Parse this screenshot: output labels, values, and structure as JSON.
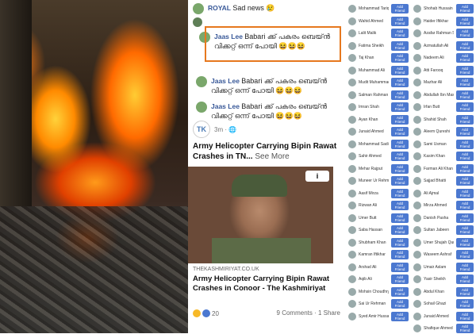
{
  "comments": [
    {
      "name": "ROYAL",
      "text": "Sad news 😢"
    },
    {
      "name": "Jaas Lee",
      "text": "Babari ക്ക് പകരം ബെയ്ൻ വിക്കറ്റ് ഒന്ന് പോയി 😆😆😆"
    },
    {
      "name": "Jaas Lee",
      "text": "Babari ക്ക് പകരം ബെയ്ൻ വിക്കറ്റ് ഒന്ന് പോയി 😆😆😆"
    },
    {
      "name": "Jaas Lee",
      "text": "Babari ക്ക് പകരം ബെയ്ൻ വിക്കറ്റ് ഒന്ന് പോയി 😆😆😆"
    }
  ],
  "post": {
    "logo": "TK",
    "time": "3m · 🌐",
    "title": "Army Helicopter Carrying Bipin Rawat Crashes in TN...",
    "see_more": "See More",
    "badge": "i",
    "source": "THEKASHMIRIYAT.CO.UK",
    "link_title": "Army Helicopter Carrying Bipin Rawat Crashes in Conoor - The Kashmiriyat",
    "reaction_count": "20",
    "stats": "9 Comments · 1 Share"
  },
  "people_col1": [
    "Mohammad Tariq",
    "Wahid Ahmed",
    "Lalit Malik",
    "Fatima Sheikh",
    "Taj Khan",
    "Muhammad Ali",
    "Mudit Muhammad",
    "Salman Rahman",
    "Imran Shah",
    "Ayan Khan",
    "Junaid Ahmed",
    "Mohammad Sadiq",
    "Sahir Ahmed",
    "Mehar Rajput",
    "Muneer Ur Rehman",
    "Aasif Mirza",
    "Rizwan Ali",
    "Umer Butt",
    "Saba Hassan",
    "Shubham Khan",
    "Kamran Iftikhar",
    "Arshad Ali",
    "Aqib Ali",
    "Mohsin Choudhry",
    "Sai Ur Rehman",
    "Syed Amir Hussain"
  ],
  "people_col2": [
    "Shohab Hussain",
    "Haider Iftikhar",
    "Azafar Rahman Sultan",
    "Azmatullah Ali",
    "Nadeem Ali",
    "Atti Farooq",
    "Mazhar Ali",
    "Abdullah Ibn Masud",
    "Irfan Butt",
    "Shahid Shah",
    "Aleem Qureshi",
    "Sami Usman",
    "Kasim Khan",
    "Farman Ali Khan",
    "Sajjad Bhatti",
    "Ali Ajmal",
    "Mirza Ahmed",
    "Danish Pasha",
    "Sultan Jabeen",
    "Umer Shujah Qureshi",
    "Waseem Ashraf",
    "Umair Aslam",
    "Yasir Sheikh",
    "Abdul Khan",
    "Sohail Ghazi",
    "Junaid Ahmed",
    "Shafique Ahmed"
  ],
  "button": "Add Friend",
  "colors": {
    "link": "#385898",
    "highlight": "#e6781e",
    "button": "#4b78d0"
  }
}
